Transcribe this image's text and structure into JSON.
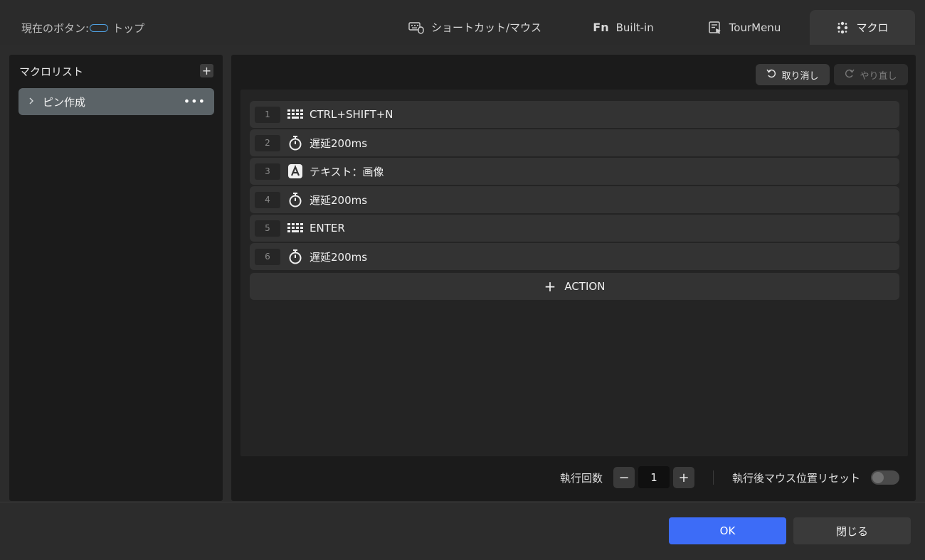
{
  "header": {
    "current_button_label": "現在のボタン:",
    "current_button_value": "トップ",
    "tabs": [
      {
        "label": "ショートカット/マウス",
        "icon": "keyboard-mouse-icon",
        "active": false
      },
      {
        "label": "Built-in",
        "icon": "fn-icon",
        "active": false
      },
      {
        "label": "TourMenu",
        "icon": "tour-menu-icon",
        "active": false
      },
      {
        "label": "マクロ",
        "icon": "macro-dots-icon",
        "active": true
      }
    ]
  },
  "macro_list": {
    "title": "マクロリスト",
    "add_label": "+",
    "items": [
      {
        "name": "ピン作成",
        "selected": true
      }
    ],
    "more_label": "•••"
  },
  "toolbar": {
    "undo_label": "取り消し",
    "redo_label": "やり直し"
  },
  "actions": [
    {
      "num": "1",
      "icon": "keyboard-icon",
      "text": "CTRL+SHIFT+N"
    },
    {
      "num": "2",
      "icon": "timer-icon",
      "text": "遅延200ms"
    },
    {
      "num": "3",
      "icon": "text-a-icon",
      "text": "テキスト：画像"
    },
    {
      "num": "4",
      "icon": "timer-icon",
      "text": "遅延200ms"
    },
    {
      "num": "5",
      "icon": "keyboard-icon",
      "text": "ENTER"
    },
    {
      "num": "6",
      "icon": "timer-icon",
      "text": "遅延200ms"
    }
  ],
  "add_action_label": "ACTION",
  "execution": {
    "count_label": "執行回数",
    "count_value": "1",
    "minus_label": "−",
    "plus_label": "+",
    "reset_label": "執行後マウス位置リセット",
    "reset_enabled": false
  },
  "footer": {
    "ok_label": "OK",
    "close_label": "閉じる"
  },
  "colors": {
    "accent": "#3d6cf7",
    "selected_item": "#5b6367",
    "current_button_pill": "#4fa0e0"
  }
}
